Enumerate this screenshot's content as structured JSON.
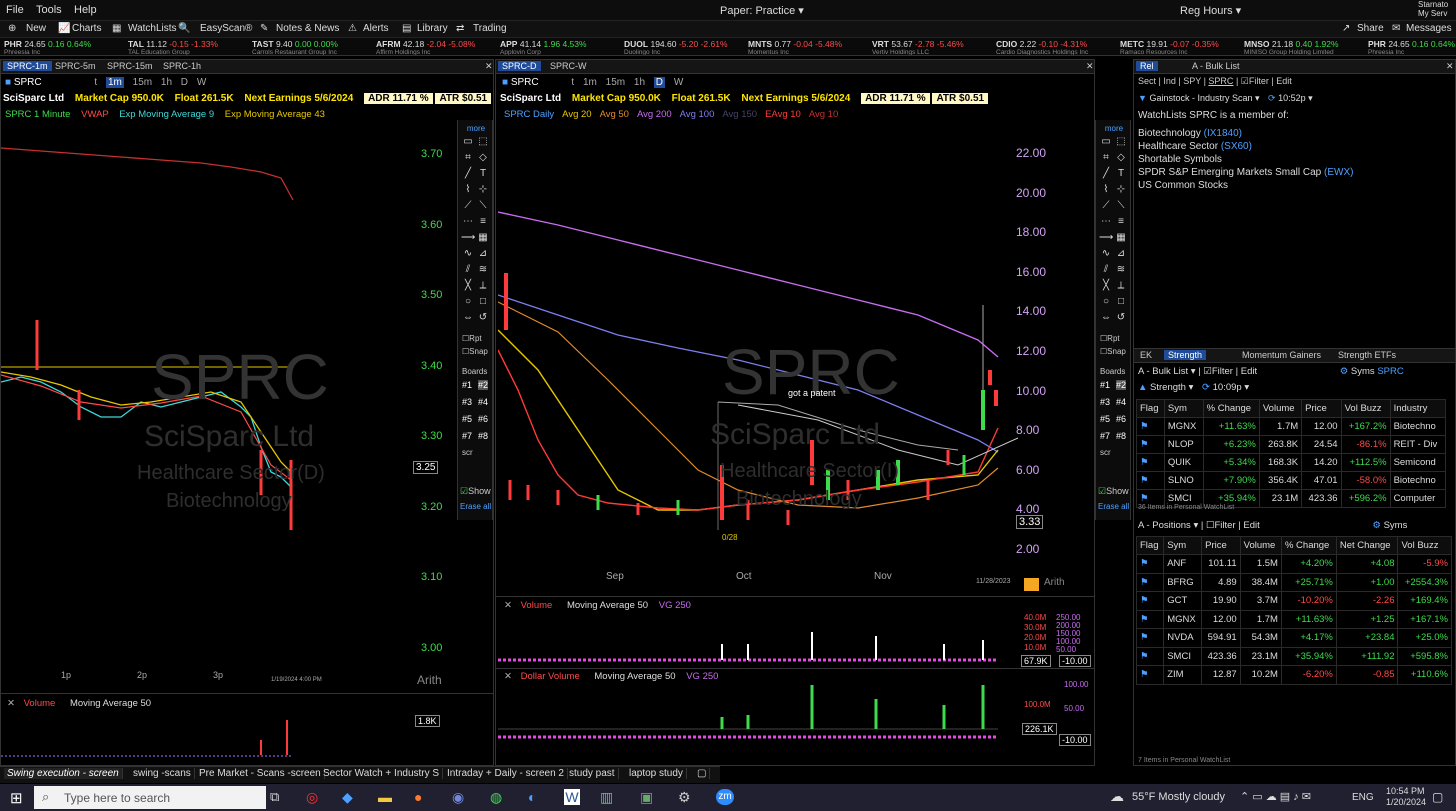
{
  "menu": {
    "file": "File",
    "tools": "Tools",
    "help": "Help",
    "center": "Paper: Practice ▾",
    "hours": "Reg Hours ▾",
    "user1": "Starnato",
    "user2": "My Serv"
  },
  "toolbar": {
    "new": "New",
    "charts": "Charts",
    "watchlists": "WatchLists",
    "easyscan": "EasyScan®",
    "notes": "Notes & News",
    "alerts": "Alerts",
    "library": "Library",
    "trading": "Trading",
    "share": "Share",
    "messages": "Messages"
  },
  "ticker": [
    {
      "sym": "PHR",
      "last": "24.65",
      "chg": "0.16",
      "pct": "0.64%",
      "dir": "up",
      "name": "Phreesia Inc"
    },
    {
      "sym": "TAL",
      "last": "11.12",
      "chg": "-0.15",
      "pct": "-1.33%",
      "dir": "dn",
      "name": "TAL Education Group"
    },
    {
      "sym": "TAST",
      "last": "9.40",
      "chg": "0.00",
      "pct": "0.00%",
      "dir": "up",
      "name": "Carrols Restaurant Group Inc"
    },
    {
      "sym": "AFRM",
      "last": "42.18",
      "chg": "-2.04",
      "pct": "-5.08%",
      "dir": "dn",
      "name": "Affirm Holdings Inc"
    },
    {
      "sym": "APP",
      "last": "41.14",
      "chg": "1.96",
      "pct": "4.53%",
      "dir": "up",
      "name": "Applovin Corp"
    },
    {
      "sym": "DUOL",
      "last": "194.60",
      "chg": "-5.20",
      "pct": "-2.61%",
      "dir": "dn",
      "name": "Duolingo Inc"
    },
    {
      "sym": "MNTS",
      "last": "0.77",
      "chg": "-0.04",
      "pct": "-5.48%",
      "dir": "dn",
      "name": "Momentus Inc"
    },
    {
      "sym": "VRT",
      "last": "53.67",
      "chg": "-2.78",
      "pct": "-5.46%",
      "dir": "dn",
      "name": "Vertiv Holdings LLC"
    },
    {
      "sym": "CDIO",
      "last": "2.22",
      "chg": "-0.10",
      "pct": "-4.31%",
      "dir": "dn",
      "name": "Cardio Diagnostics Holdings Inc"
    },
    {
      "sym": "METC",
      "last": "19.91",
      "chg": "-0.07",
      "pct": "-0.35%",
      "dir": "dn",
      "name": "Ramaco Resources Inc"
    },
    {
      "sym": "MNSO",
      "last": "21.18",
      "chg": "0.40",
      "pct": "1.92%",
      "dir": "up",
      "name": "MINISO Group Holding Limited"
    },
    {
      "sym": "PHR",
      "last": "24.65",
      "chg": "0.16",
      "pct": "0.64%",
      "dir": "up",
      "name": "Phreesia Inc"
    }
  ],
  "left": {
    "tabs": [
      "SPRC-1m",
      "SPRC-5m",
      "SPRC-15m",
      "SPRC-1h"
    ],
    "symbol": "SPRC",
    "timeframes": [
      "t",
      "1m",
      "15m",
      "1h",
      "D",
      "W"
    ],
    "company": "SciSparc Ltd",
    "mktcap": "Market Cap 950.0K",
    "float": "Float 261.5K",
    "earnings": "Next Earnings 5/6/2024",
    "adr": "ADR 11.71 %",
    "atr": "ATR  $0.51",
    "studies": [
      "SPRC 1 Minute",
      "VWAP",
      "Exp Moving Average 9",
      "Exp Moving Average 43"
    ],
    "yticks": [
      "3.70",
      "3.60",
      "3.50",
      "3.40",
      "3.30",
      "3.20",
      "3.10",
      "3.00"
    ],
    "price_tag": "3.25",
    "xticks": [
      "1p",
      "2p",
      "3p"
    ],
    "date": "1/19/2024 4:00 PM",
    "scale": "Arith",
    "vol_label": "Volume",
    "vol_ma": "Moving Average 50",
    "vol_tag": "1.8K",
    "watermark": {
      "sym": "SPRC",
      "name": "SciSparc Ltd",
      "sector": "Healthcare Sector(D)",
      "industry": "Biotechnology"
    }
  },
  "tools": {
    "more": "more",
    "rpt": "Rpt",
    "snap": "Snap",
    "boards": "Boards",
    "board_items": [
      "#1",
      "#2",
      "#3",
      "#4",
      "#5",
      "#6",
      "#7",
      "#8"
    ],
    "scr": "scr",
    "show": "Show",
    "erase": "Erase all"
  },
  "mid": {
    "tabs": [
      "SPRC-D",
      "SPRC-W"
    ],
    "symbol": "SPRC",
    "timeframes": [
      "t",
      "1m",
      "15m",
      "1h",
      "D",
      "W"
    ],
    "company": "SciSparc Ltd",
    "mktcap": "Market Cap 950.0K",
    "float": "Float 261.5K",
    "earnings": "Next Earnings 5/6/2024",
    "adr": "ADR 11.71 %",
    "atr": "ATR  $0.51",
    "studies": [
      {
        "t": "SPRC Daily",
        "c": "#4ea0ff"
      },
      {
        "t": "Avg 20",
        "c": "#e6c700"
      },
      {
        "t": "Avg 50",
        "c": "#e08a2e"
      },
      {
        "t": "Avg 200",
        "c": "#c76cf0"
      },
      {
        "t": "Avg 100",
        "c": "#7e7ef0"
      },
      {
        "t": "Avg 150",
        "c": "#446"
      },
      {
        "t": "EAvg 10",
        "c": "#ff3a3a"
      },
      {
        "t": "Avg 10",
        "c": "#c53030"
      }
    ],
    "yticks": [
      "22.00",
      "20.00",
      "18.00",
      "16.00",
      "14.00",
      "12.00",
      "10.00",
      "8.00",
      "6.00",
      "4.00",
      "2.00"
    ],
    "price_tag": "3.33",
    "xticks": [
      "Sep",
      "Oct",
      "Nov"
    ],
    "date": "11/28/2023",
    "annotation": "got a patent",
    "low_label": "0/28",
    "scale": "Arith",
    "vol_label": "Volume",
    "vol_ma": "Moving Average 50",
    "vol_vg": "VG 250",
    "vol_ticks": [
      "40.0M",
      "30.0M",
      "20.0M",
      "10.0M"
    ],
    "vol_ticks2": [
      "250.00",
      "200.00",
      "150.00",
      "100.00",
      "50.00"
    ],
    "vol_tag": "67.9K",
    "vol_tag2": "-10.00",
    "dv_label": "Dollar Volume",
    "dv_ma": "Moving Average 50",
    "dv_vg": "VG 250",
    "dv_ticks": [
      "100.00",
      "50.00"
    ],
    "dv_tick": "100.0M",
    "dv_tag": "226.1K",
    "dv_tag2": "-10.00",
    "watermark": {
      "sym": "SPRC",
      "name": "SciSparc Ltd",
      "sector": "Healthcare Sector(I)",
      "industry": "Biotechnology"
    }
  },
  "right": {
    "tabs": [
      "Rel",
      "A - Bulk List"
    ],
    "subtabs": [
      "Sect",
      "Ind",
      "SPY",
      "SPRC",
      "Filter",
      "Edit"
    ],
    "scan": "Gainstock - Industry Scan ▾",
    "time": "10:52p ▾",
    "member_title": "WatchLists SPRC is a member of:",
    "members": [
      {
        "t": "Biotechnology",
        "c": "(IX1840)"
      },
      {
        "t": "Healthcare Sector",
        "c": "(SX60)"
      },
      {
        "t": "Shortable Symbols",
        "c": ""
      },
      {
        "t": "SPDR S&P Emerging Markets Small Cap",
        "c": "(EWX)"
      },
      {
        "t": "US Common Stocks",
        "c": ""
      }
    ],
    "wl_tabs": [
      "EK",
      "Strength",
      "Momentum Gainers",
      "Strength ETFs"
    ],
    "wl_name": "A - Bulk List",
    "wl_filter": "Filter",
    "wl_edit": "Edit",
    "wl_syms": "Syms",
    "wl_sprc": "SPRC",
    "wl_strength": "Strength",
    "wl_time": "10:09p",
    "wl_cols": [
      "Flag",
      "Sym",
      "% Change",
      "Volume",
      "Price",
      "Vol Buzz",
      "Industry"
    ],
    "wl_rows": [
      [
        "MGNX",
        "+11.63%",
        "1.7M",
        "12.00",
        "+167.2%",
        "Biotechno"
      ],
      [
        "NLOP",
        "+6.23%",
        "263.8K",
        "24.54",
        "-86.1%",
        "REIT - Div"
      ],
      [
        "QUIK",
        "+5.34%",
        "168.3K",
        "14.20",
        "+112.5%",
        "Semicond"
      ],
      [
        "SLNO",
        "+7.90%",
        "356.4K",
        "47.01",
        "-58.0%",
        "Biotechno"
      ],
      [
        "SMCI",
        "+35.94%",
        "23.1M",
        "423.36",
        "+596.2%",
        "Computer"
      ]
    ],
    "wl_footer": "36 Items in Personal WatchList",
    "pos_name": "A - Positions",
    "pos_filter": "Filter",
    "pos_edit": "Edit",
    "pos_syms": "Syms",
    "pos_cols": [
      "Flag",
      "Sym",
      "Price",
      "Volume",
      "% Change",
      "Net Change",
      "Vol Buzz"
    ],
    "pos_rows": [
      [
        "ANF",
        "101.11",
        "1.5M",
        "+4.20%",
        "+4.08",
        "-5.9%"
      ],
      [
        "BFRG",
        "4.89",
        "38.4M",
        "+25.71%",
        "+1.00",
        "+2554.3%"
      ],
      [
        "GCT",
        "19.90",
        "3.7M",
        "-10.20%",
        "-2.26",
        "+169.4%"
      ],
      [
        "MGNX",
        "12.00",
        "1.7M",
        "+11.63%",
        "+1.25",
        "+167.1%"
      ],
      [
        "NVDA",
        "594.91",
        "54.3M",
        "+4.17%",
        "+23.84",
        "+25.0%"
      ],
      [
        "SMCI",
        "423.36",
        "23.1M",
        "+35.94%",
        "+111.92",
        "+595.8%"
      ],
      [
        "ZIM",
        "12.87",
        "10.2M",
        "-6.20%",
        "-0.85",
        "+110.6%"
      ]
    ],
    "pos_footer": "7 Items in Personal WatchList"
  },
  "workspaces": [
    "Swing execution - screen",
    "swing -scans",
    "Pre Market - Scans -screen",
    "Sector Watch + Industry S",
    "Intraday + Daily - screen 2",
    "study past",
    "laptop study"
  ],
  "taskbar": {
    "search": "Type here to search",
    "weather": "55°F  Mostly cloudy",
    "lang": "ENG",
    "time": "10:54 PM",
    "date": "1/20/2024"
  }
}
